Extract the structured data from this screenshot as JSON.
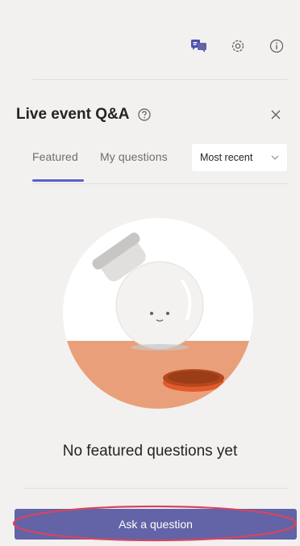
{
  "toolbar": {
    "icons": [
      "qa-chat-icon",
      "settings-icon",
      "info-icon"
    ]
  },
  "header": {
    "title": "Live event Q&A"
  },
  "tabs": [
    {
      "label": "Featured",
      "selected": true
    },
    {
      "label": "My questions",
      "selected": false
    }
  ],
  "sort": {
    "selected": "Most recent"
  },
  "empty_state": {
    "message": "No featured questions yet"
  },
  "actions": {
    "ask_label": "Ask a question"
  },
  "colors": {
    "accent": "#6264a7",
    "tab_indicator": "#5b5fc7",
    "highlight_ring": "#d64561",
    "background": "#f2f1ef"
  }
}
